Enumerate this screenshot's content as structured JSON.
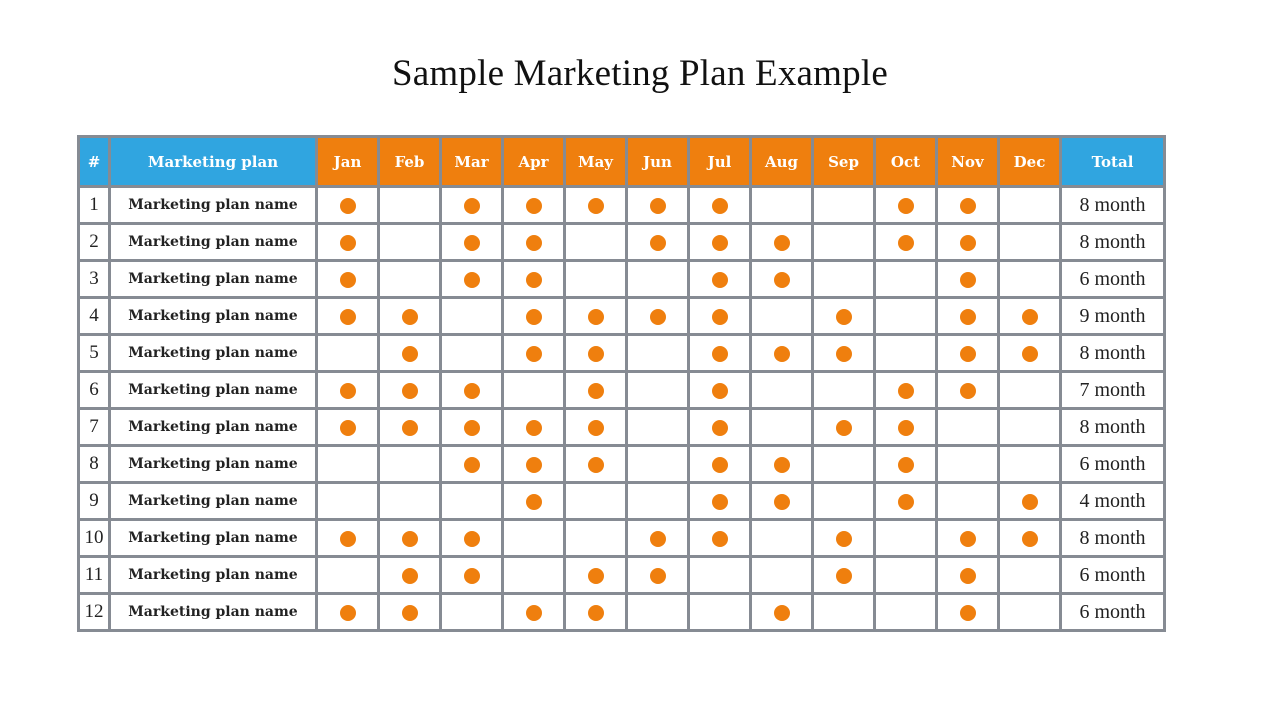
{
  "title": "Sample Marketing Plan Example",
  "colors": {
    "header_blue": "#30a5e0",
    "header_orange": "#ef7f0e",
    "dot": "#ef7f0e",
    "grid": "#868b93"
  },
  "table": {
    "headers": {
      "num": "#",
      "name": "Marketing plan",
      "months": [
        "Jan",
        "Feb",
        "Mar",
        "Apr",
        "May",
        "Jun",
        "Jul",
        "Aug",
        "Sep",
        "Oct",
        "Nov",
        "Dec"
      ],
      "total": "Total"
    },
    "rows": [
      {
        "num": "1",
        "name": "Marketing plan name",
        "active": [
          1,
          0,
          1,
          1,
          1,
          1,
          1,
          0,
          0,
          1,
          1,
          0
        ],
        "total": "8 month"
      },
      {
        "num": "2",
        "name": "Marketing plan name",
        "active": [
          1,
          0,
          1,
          1,
          0,
          1,
          1,
          1,
          0,
          1,
          1,
          0
        ],
        "total": "8 month"
      },
      {
        "num": "3",
        "name": "Marketing plan name",
        "active": [
          1,
          0,
          1,
          1,
          0,
          0,
          1,
          1,
          0,
          0,
          1,
          0
        ],
        "total": "6 month"
      },
      {
        "num": "4",
        "name": "Marketing plan name",
        "active": [
          1,
          1,
          0,
          1,
          1,
          1,
          1,
          0,
          1,
          0,
          1,
          1
        ],
        "total": "9 month"
      },
      {
        "num": "5",
        "name": "Marketing plan name",
        "active": [
          0,
          1,
          0,
          1,
          1,
          0,
          1,
          1,
          1,
          0,
          1,
          1
        ],
        "total": "8 month"
      },
      {
        "num": "6",
        "name": "Marketing plan name",
        "active": [
          1,
          1,
          1,
          0,
          1,
          0,
          1,
          0,
          0,
          1,
          1,
          0
        ],
        "total": "7 month"
      },
      {
        "num": "7",
        "name": "Marketing plan name",
        "active": [
          1,
          1,
          1,
          1,
          1,
          0,
          1,
          0,
          1,
          1,
          0,
          0
        ],
        "total": "8 month"
      },
      {
        "num": "8",
        "name": "Marketing plan name",
        "active": [
          0,
          0,
          1,
          1,
          1,
          0,
          1,
          1,
          0,
          1,
          0,
          0
        ],
        "total": "6 month"
      },
      {
        "num": "9",
        "name": "Marketing plan name",
        "active": [
          0,
          0,
          0,
          1,
          0,
          0,
          1,
          1,
          0,
          1,
          0,
          1
        ],
        "total": "4 month"
      },
      {
        "num": "10",
        "name": "Marketing plan name",
        "active": [
          1,
          1,
          1,
          0,
          0,
          1,
          1,
          0,
          1,
          0,
          1,
          1
        ],
        "total": "8 month"
      },
      {
        "num": "11",
        "name": "Marketing plan name",
        "active": [
          0,
          1,
          1,
          0,
          1,
          1,
          0,
          0,
          1,
          0,
          1,
          0
        ],
        "total": "6 month"
      },
      {
        "num": "12",
        "name": "Marketing plan name",
        "active": [
          1,
          1,
          0,
          1,
          1,
          0,
          0,
          1,
          0,
          0,
          1,
          0
        ],
        "total": "6 month"
      }
    ]
  }
}
